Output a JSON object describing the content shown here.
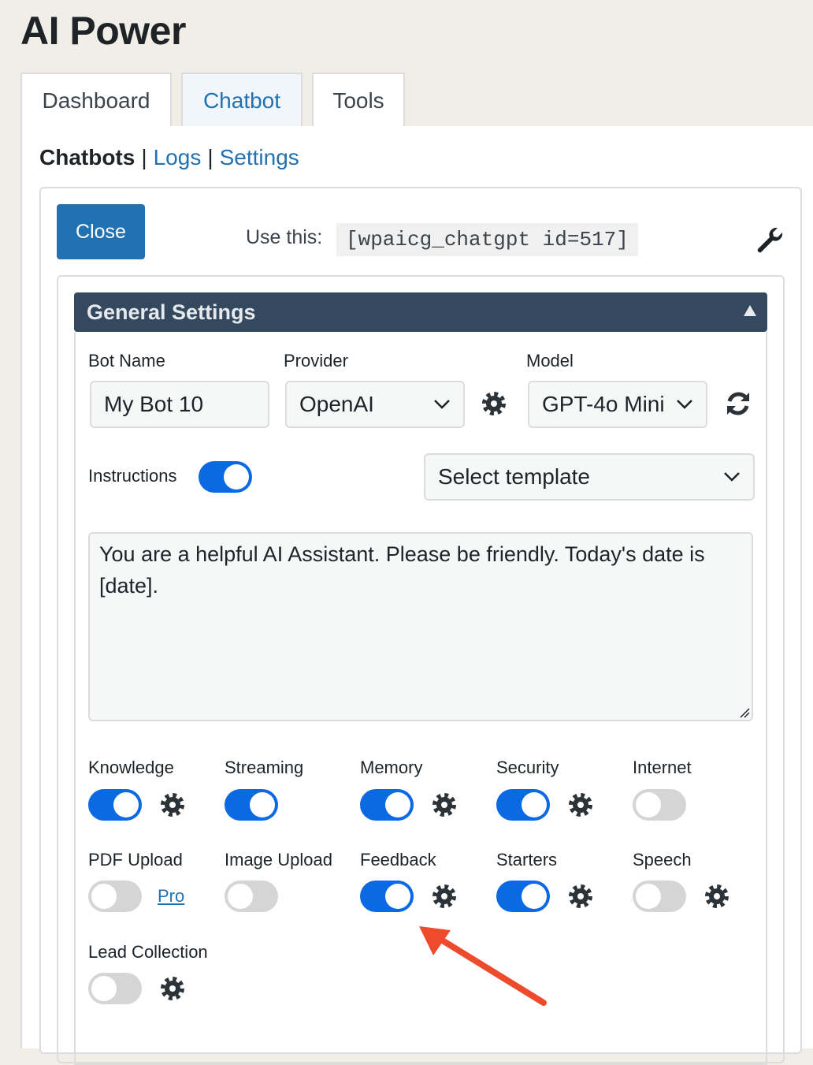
{
  "app": {
    "title": "AI Power"
  },
  "tabs": [
    {
      "label": "Dashboard"
    },
    {
      "label": "Chatbot"
    },
    {
      "label": "Tools"
    }
  ],
  "subnav": {
    "current": "Chatbots",
    "separator": "|",
    "logs": "Logs",
    "settings": "Settings"
  },
  "bot": {
    "close_label": "Close",
    "shortcode_label": "Use this:",
    "shortcode": "[wpaicg_chatgpt id=517]"
  },
  "general": {
    "title": "General Settings",
    "bot_name_label": "Bot Name",
    "bot_name_value": "My Bot 10",
    "provider_label": "Provider",
    "provider_value": "OpenAI",
    "model_label": "Model",
    "model_value": "GPT-4o Mini",
    "instructions_label": "Instructions",
    "instructions_on": true,
    "template_value": "Select template",
    "instructions_text": "You are a helpful AI Assistant. Please be friendly. Today's date is [date]."
  },
  "features": {
    "knowledge": {
      "label": "Knowledge",
      "on": true
    },
    "streaming": {
      "label": "Streaming",
      "on": true
    },
    "memory": {
      "label": "Memory",
      "on": true
    },
    "security": {
      "label": "Security",
      "on": true
    },
    "internet": {
      "label": "Internet",
      "on": false
    },
    "pdf_upload": {
      "label": "PDF Upload",
      "on": false,
      "pro": "Pro"
    },
    "image_upload": {
      "label": "Image Upload",
      "on": false
    },
    "feedback": {
      "label": "Feedback",
      "on": true
    },
    "starters": {
      "label": "Starters",
      "on": true
    },
    "speech": {
      "label": "Speech",
      "on": false
    },
    "lead_collection": {
      "label": "Lead Collection",
      "on": false
    }
  },
  "colors": {
    "accent": "#2271b1",
    "toggle_on": "#0b69e3",
    "toggle_off": "#d5d5d5",
    "header_bg": "#34495e",
    "annotation_arrow": "#ee4a2c"
  }
}
